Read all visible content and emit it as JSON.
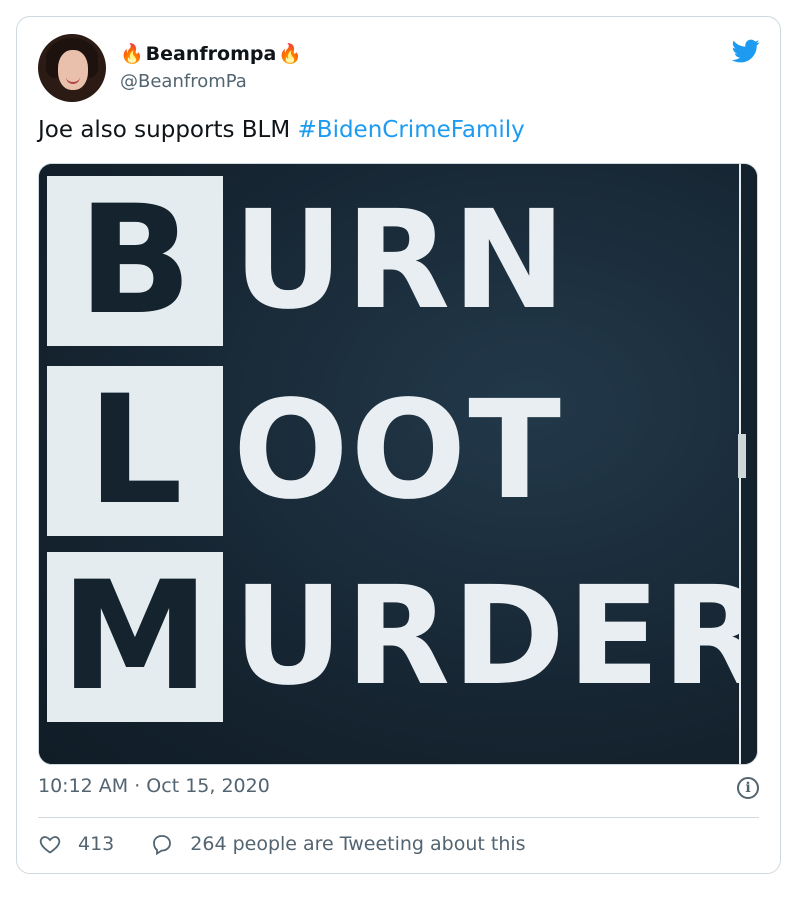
{
  "tweet": {
    "author": {
      "display_name": "Beanfrompa",
      "name_emoji": "🔥",
      "handle": "@BeanfromPa",
      "avatar": "user-avatar-photo"
    },
    "text": "Joe also supports BLM",
    "hashtag": "#BidenCrimeFamily",
    "media": {
      "lines": [
        {
          "initial": "B",
          "rest": "URN"
        },
        {
          "initial": "L",
          "rest": "OOT"
        },
        {
          "initial": "M",
          "rest": "URDER"
        }
      ]
    },
    "timestamp": "10:12 AM · Oct 15, 2020",
    "likes": "413",
    "conversation": "264 people are Tweeting about this"
  },
  "icons": {
    "logo": "twitter-bird-icon",
    "info": "info-icon",
    "like": "heart-icon",
    "reply": "speech-bubble-icon"
  },
  "colors": {
    "link": "#1d9bf0",
    "secondary_text": "#536471",
    "border": "#cfd9de"
  }
}
